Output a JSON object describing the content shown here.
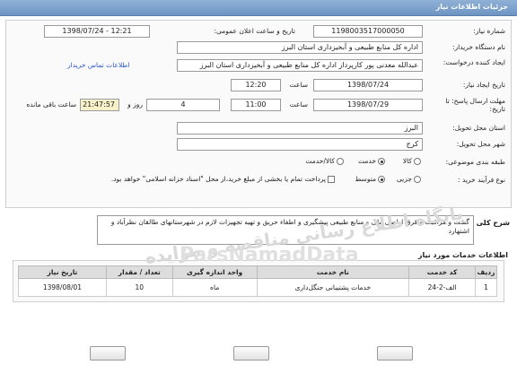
{
  "titlebar": {
    "title": "جزئیات اطلاعات نیاز"
  },
  "fields": {
    "need_number": {
      "label": "شماره نیاز:",
      "value": "1198003517000050"
    },
    "announce_date": {
      "label": "تاریخ و ساعت اعلان عمومی:",
      "value": "1398/07/24 - 12:21"
    },
    "buyer_org": {
      "label": "نام دستگاه خریدار:",
      "value": "اداره کل منابع طبیعی و آبخیزداری استان البرز"
    },
    "requester": {
      "label": "ایجاد کننده درخواست:",
      "value": "عبدالله  معدنی پور کارپرداز اداره کل منابع طبیعی و آبخیزداری استان البرز"
    },
    "buyer_contact_link": "اطلاعات تماس خریدار",
    "create_date": {
      "label": "تاریخ ایجاد نیاز:",
      "date": "1398/07/24",
      "time_label": "ساعت",
      "time": "12:20"
    },
    "deadline": {
      "label": "مهلت ارسال پاسخ: تا تاریخ:",
      "date": "1398/07/29",
      "time_label": "ساعت",
      "time": "11:00",
      "days": "4",
      "days_label": "روز و",
      "remaining": "21:47:57",
      "remaining_label": "ساعت باقی مانده"
    },
    "province": {
      "label": "استان محل تحویل:",
      "value": "البرز"
    },
    "city": {
      "label": "شهر محل تحویل:",
      "value": "کرج"
    },
    "category": {
      "label": "طبقه بندی موضوعی:",
      "options": [
        "کالا",
        "خدمت",
        "کالا/خدمت"
      ],
      "selected": "خدمت"
    },
    "purchase_type": {
      "label": "نوع فرآیند خرید :",
      "options": [
        "جزیی",
        "متوسط"
      ],
      "selected": "متوسط",
      "checkbox_text": "پرداخت تمام یا بخشی از مبلغ خرید،از محل \"اسناد خزانه اسلامی\" خواهد بود."
    }
  },
  "description": {
    "label": "شرح کلی نیاز:",
    "text": "گشت و مراقبت و قرق اراضی ملی و منابع طبیعی پیشگیری و اطفاء حریق و تهیه تجهیزات لازم در شهرستانهای طالقان نظرآباد و اشتهارد"
  },
  "services": {
    "title": "اطلاعات خدمات مورد نیاز",
    "columns": [
      "ردیف",
      "کد خدمت",
      "نام خدمت",
      "واحد اندازه گیری",
      "تعداد / مقدار",
      "تاریخ نیاز"
    ],
    "rows": [
      {
        "index": "1",
        "code": "الف-2-24",
        "name": "خدمات پشتیبانی جنگل‌داری",
        "unit": "ماه",
        "qty": "10",
        "date": "1398/08/01"
      }
    ]
  },
  "watermark": {
    "line1": "پایگاه اطلاع رسانی مناقصه و مزایده",
    "line2": "ParsNamadData"
  },
  "colors": {
    "titlebar": "#7fa3cf",
    "link": "#2a57c9",
    "remaining_bg": "#f6f1c8"
  }
}
